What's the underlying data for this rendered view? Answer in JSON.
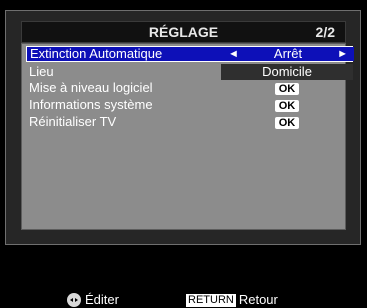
{
  "header": {
    "title": "RÉGLAGE",
    "page": "2/2"
  },
  "menu": {
    "items": [
      {
        "label": "Extinction Automatique",
        "value": "Arrêt",
        "left_arrow": "◄",
        "right_arrow": "►"
      },
      {
        "label": "Lieu",
        "value": "Domicile"
      },
      {
        "label": "Mise à niveau logiciel",
        "value": "OK"
      },
      {
        "label": "Informations système",
        "value": "OK"
      },
      {
        "label": "Réinitialiser TV",
        "value": "OK"
      }
    ]
  },
  "footer": {
    "edit_label": "Éditer",
    "return_key": "RETURN",
    "return_label": "Retour"
  },
  "colors": {
    "selection": "#0d10b8",
    "panel": "#8c8c8c",
    "background": "#000000"
  },
  "icons": {
    "navigate": "left-right-dpad-icon"
  }
}
